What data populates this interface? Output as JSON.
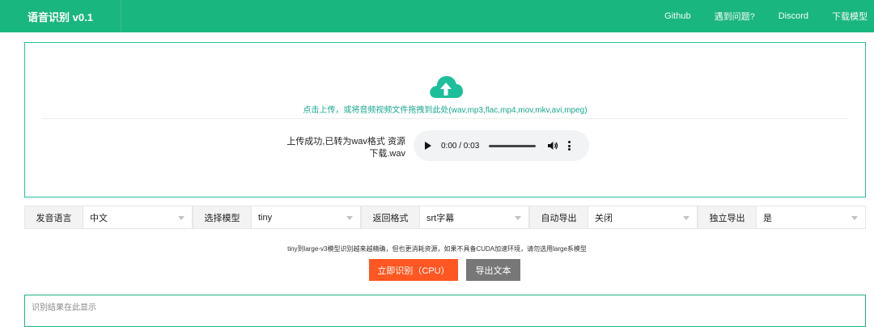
{
  "header": {
    "brand": "语音识别 v0.1",
    "nav": [
      "Github",
      "遇到问题?",
      "Discord",
      "下载模型"
    ]
  },
  "upload": {
    "icon": "cloud-upload-icon",
    "hint": "点击上传，或将音频视频文件拖拽到此处(wav,mp3,flac,mp4,mov,mkv,avi,mpeg)",
    "status": "上传成功,已转为wav格式 资源下载.wav",
    "audio_time": "0:00 / 0:03"
  },
  "options": [
    {
      "label": "发音语言",
      "value": "中文"
    },
    {
      "label": "选择模型",
      "value": "tiny"
    },
    {
      "label": "返回格式",
      "value": "srt字幕"
    },
    {
      "label": "自动导出",
      "value": "关闭"
    },
    {
      "label": "独立导出",
      "value": "是"
    }
  ],
  "tip": "tiny到large-v3模型识别越来越精确，但也更消耗资源，如果不具备CUDA加速环境，请勿选用large系模型",
  "buttons": {
    "recognize": "立即识别（CPU）",
    "export": "导出文本"
  },
  "result": {
    "placeholder": "识别结果在此显示"
  },
  "colors": {
    "primary": "#1ab67f",
    "accent": "#ff5722",
    "secondary": "#777777"
  }
}
